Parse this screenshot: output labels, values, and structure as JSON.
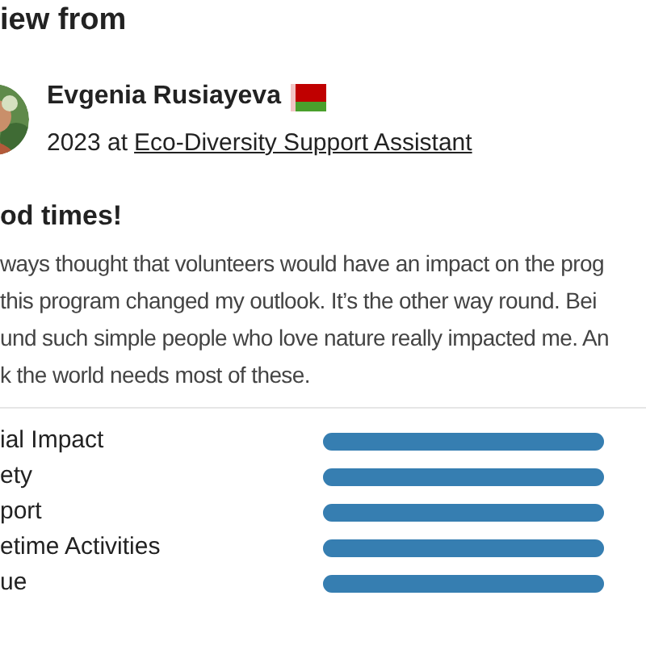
{
  "heading": "iew from",
  "reviewer": {
    "name": "Evgenia Rusiayeva",
    "year": "2023 at",
    "program": "Eco-Diversity Support Assistant"
  },
  "review": {
    "title": "od times!",
    "lines": [
      "ways thought that volunteers would have an impact on the prog",
      "this program changed my outlook. It’s the other way round. Bei",
      "und such simple people who love nature really impacted me. An",
      "k the world needs most of these."
    ]
  },
  "ratings": [
    {
      "label": "ial Impact",
      "level": 1
    },
    {
      "label": "ety",
      "level": 1
    },
    {
      "label": "port",
      "level": 1
    },
    {
      "label": "etime Activities",
      "level": 1
    },
    {
      "label": "ue",
      "level": 1
    }
  ]
}
